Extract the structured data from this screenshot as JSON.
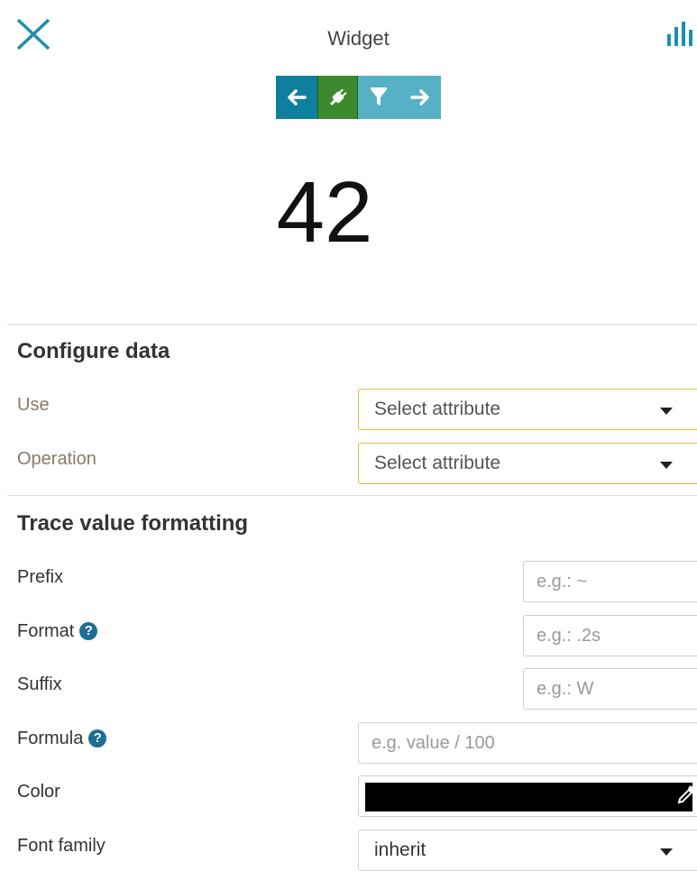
{
  "header": {
    "title": "Widget",
    "close_icon": "close-icon",
    "chart_icon": "bar-chart-icon",
    "accent": "#1d8fa8"
  },
  "toolbar": {
    "buttons": [
      {
        "icon": "arrow-left-icon",
        "color": "#0f7f9e"
      },
      {
        "icon": "plug-icon",
        "color": "#3d8a2e"
      },
      {
        "icon": "filter-icon",
        "color": "#56b1c7"
      },
      {
        "icon": "arrow-right-icon",
        "color": "#56b1c7"
      }
    ]
  },
  "widget": {
    "value": "42"
  },
  "configure_data": {
    "title": "Configure data",
    "use_label": "Use",
    "use_value": "Select attribute",
    "operation_label": "Operation",
    "operation_value": "Select attribute"
  },
  "trace_formatting": {
    "title": "Trace value formatting",
    "prefix_label": "Prefix",
    "prefix_placeholder": "e.g.: ~",
    "format_label": "Format",
    "format_placeholder": "e.g.: .2s",
    "suffix_label": "Suffix",
    "suffix_placeholder": "e.g.: W",
    "formula_label": "Formula",
    "formula_placeholder": "e.g. value / 100",
    "color_label": "Color",
    "color_value": "#000000",
    "font_family_label": "Font family",
    "font_family_value": "inherit",
    "help_glyph": "?"
  }
}
